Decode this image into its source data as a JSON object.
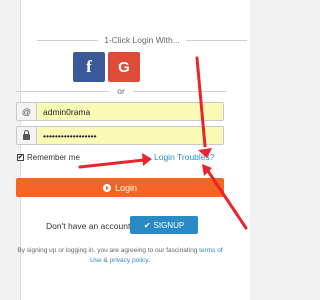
{
  "header": {
    "title": "1-Click Login With..."
  },
  "social": {
    "facebook": {
      "glyph": "f",
      "color": "#3b5998"
    },
    "google": {
      "glyph": "G",
      "color": "#dd4b39"
    }
  },
  "divider_text": "or",
  "username": {
    "icon": "at-icon",
    "glyph": "@",
    "value": "admin0rama"
  },
  "password": {
    "icon": "lock-icon",
    "value": "••••••••••••••••••"
  },
  "remember": {
    "label": "Remember me",
    "checked": true,
    "mark": "✔"
  },
  "troubles_link": "Login Troubles?",
  "login_button": {
    "label": "Login",
    "color": "#f26522"
  },
  "signup": {
    "prompt": "Don't have an account?",
    "mark": "✔",
    "button_label": "SIGNUP",
    "color": "#2a8ac6"
  },
  "terms": {
    "prefix": "By signing up or logging in, you are agreeing to our fascinating ",
    "terms_link": "terms of Use",
    "amp": " & ",
    "privacy_link": "privacy policy",
    "suffix": "."
  },
  "annotation_color": "#e8242c"
}
